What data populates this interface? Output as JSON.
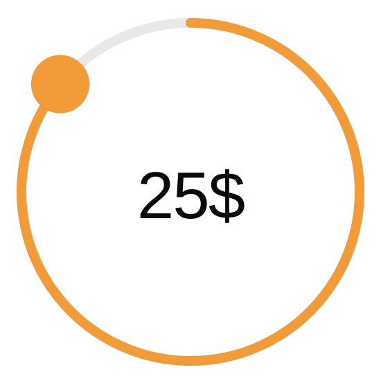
{
  "slider": {
    "value_label": "25$",
    "progress_fraction": 0.86,
    "track_color": "#e8e8e8",
    "fill_color": "#f19c38",
    "knob_color": "#f19c38",
    "direction": "clockwise-from-top"
  }
}
